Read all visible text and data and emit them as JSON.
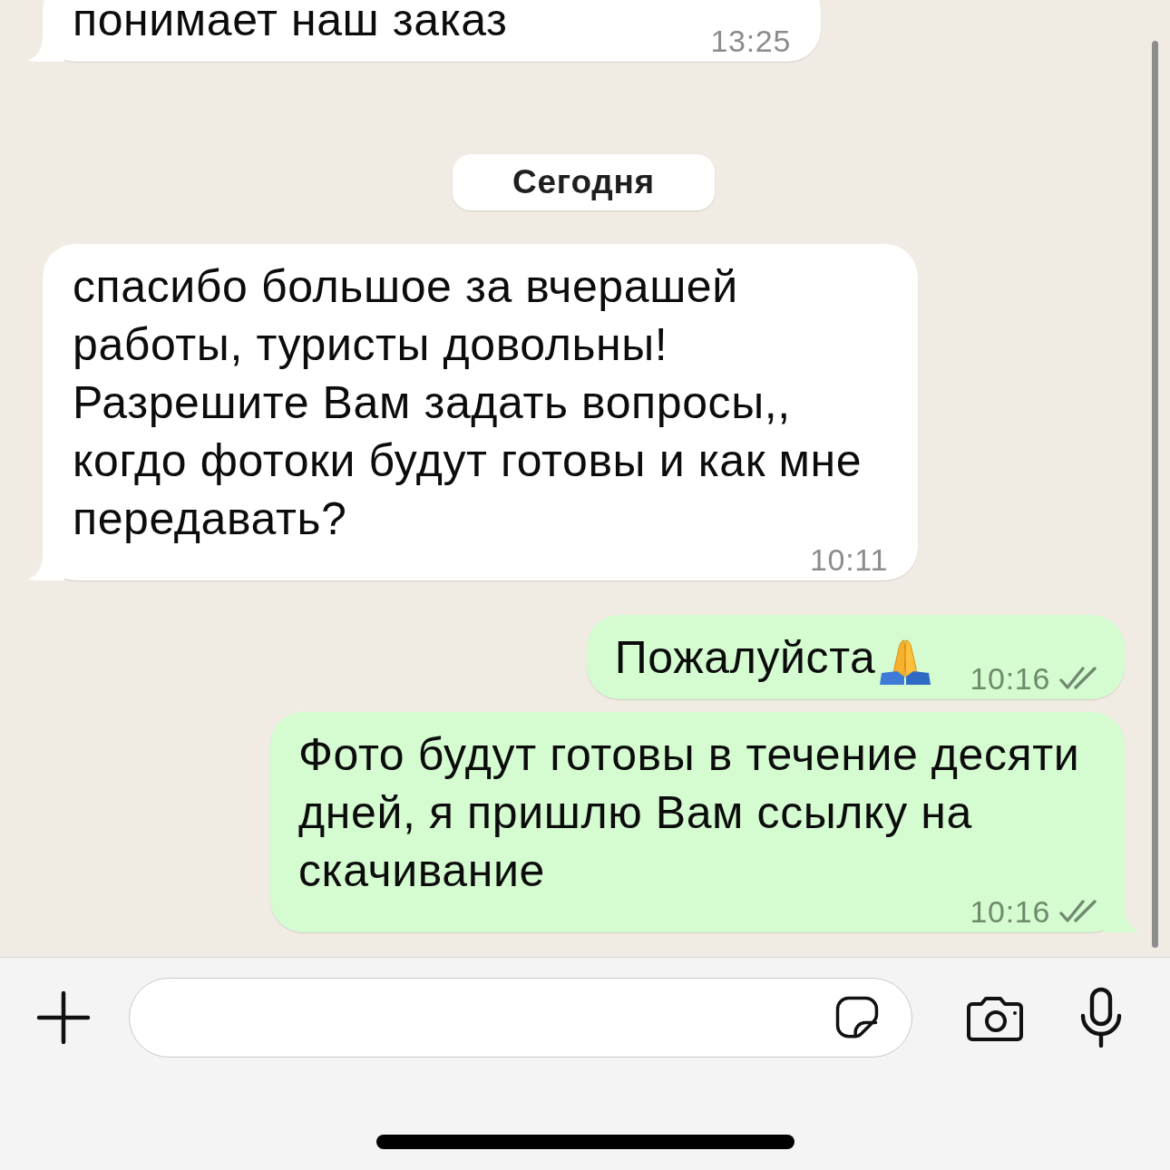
{
  "chat": {
    "messages": [
      {
        "kind": "incoming",
        "text": "понимает наш заказ",
        "time": "13:25",
        "tail": true
      },
      {
        "kind": "date",
        "label": "Сегодня"
      },
      {
        "kind": "incoming",
        "text": "спасибо большое за вчерашей работы, туристы довольны! Разрешите Вам задать вопросы,, когдо фотоки будут готовы и как мне передавать?",
        "time": "10:11",
        "tail": true
      },
      {
        "kind": "outgoing",
        "text": "Пожалуйста",
        "emoji": true,
        "time": "10:16",
        "read": false,
        "tail": false
      },
      {
        "kind": "outgoing",
        "text": "Фото будут готовы в течение десяти дней, я пришлю Вам ссылку на скачивание",
        "time": "10:16",
        "read": false,
        "tail": true
      }
    ]
  }
}
